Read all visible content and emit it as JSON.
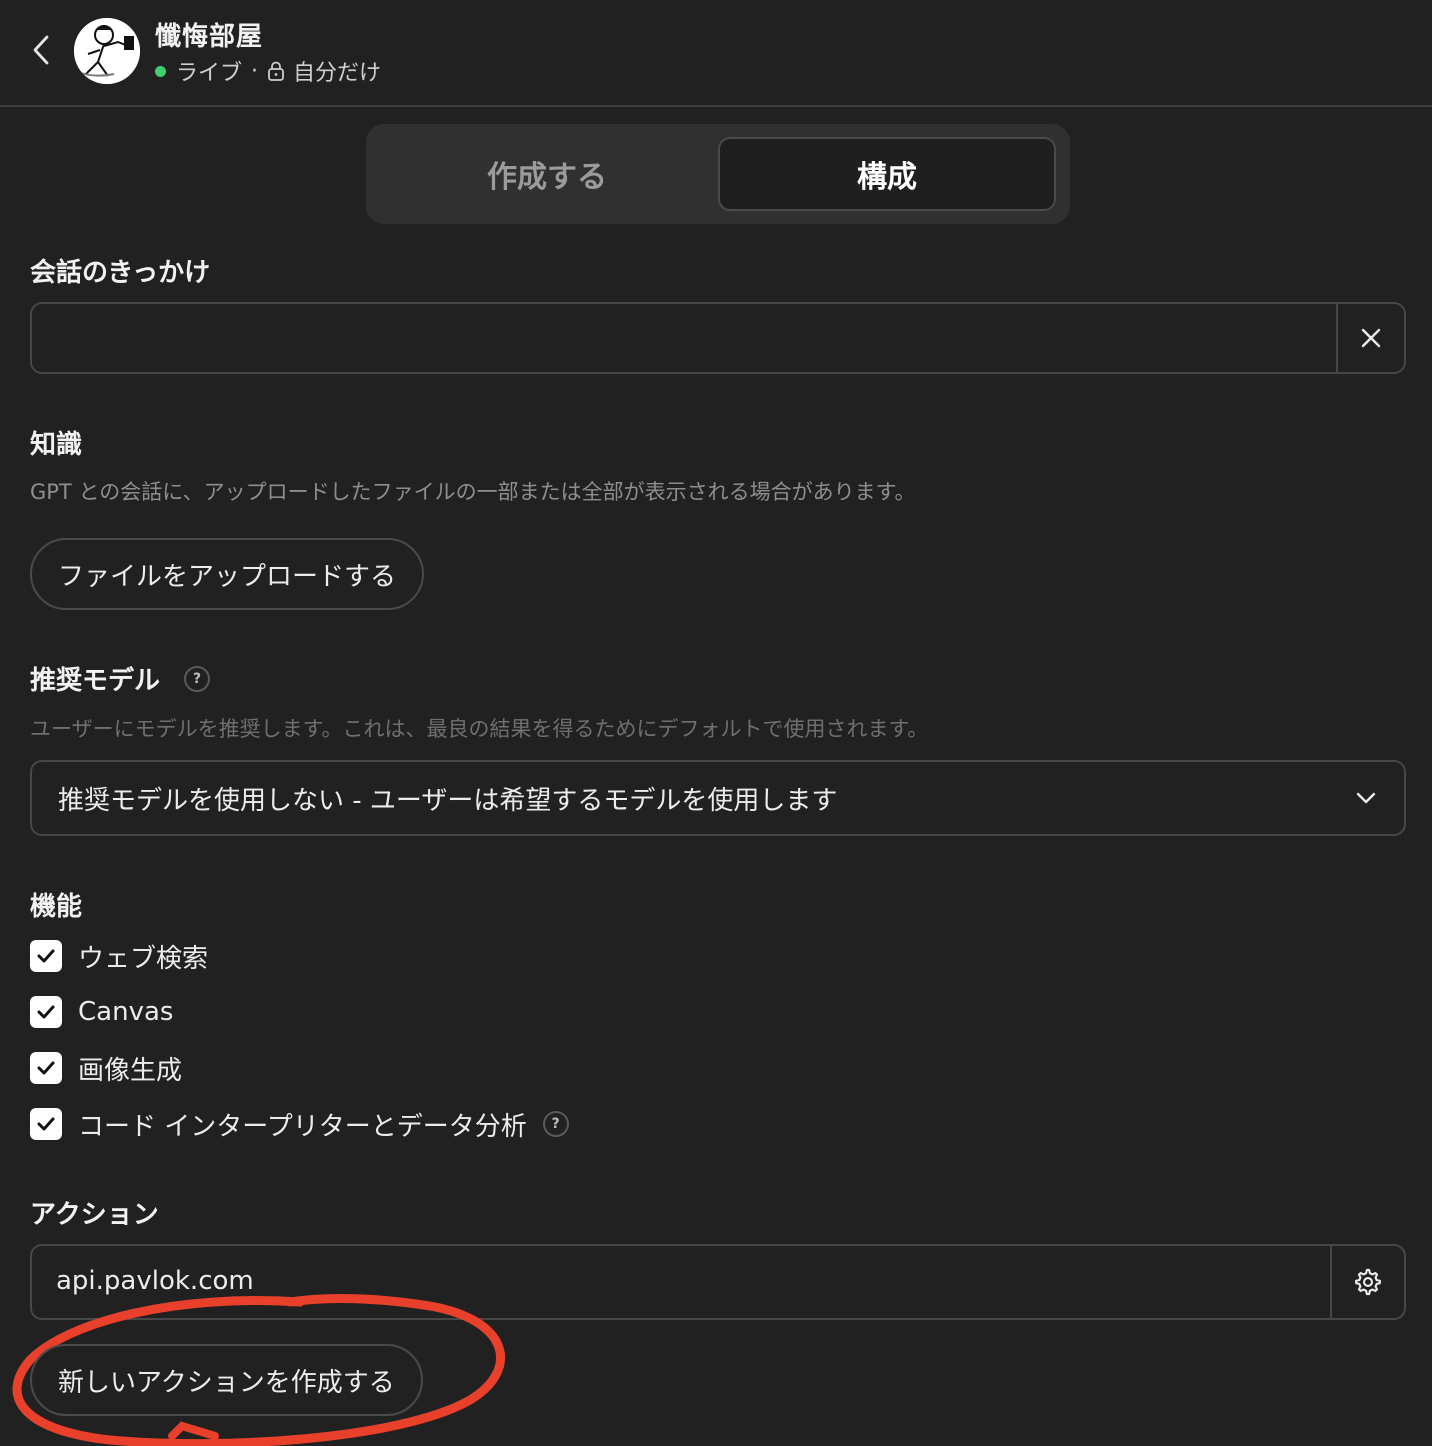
{
  "header": {
    "title": "懺悔部屋",
    "status": "ライブ",
    "separator": "·",
    "visibility": "自分だけ",
    "status_color": "#3ecf6e"
  },
  "tabs": [
    {
      "label": "作成する",
      "active": false
    },
    {
      "label": "構成",
      "active": true
    }
  ],
  "conversation_starters": {
    "title": "会話のきっかけ",
    "value": ""
  },
  "knowledge": {
    "title": "知識",
    "description": "GPT との会話に、アップロードしたファイルの一部または全部が表示される場合があります。",
    "upload_label": "ファイルをアップロードする"
  },
  "recommended_model": {
    "title": "推奨モデル",
    "help": "?",
    "description": "ユーザーにモデルを推奨します。これは、最良の結果を得るためにデフォルトで使用されます。",
    "selected": "推奨モデルを使用しない - ユーザーは希望するモデルを使用します"
  },
  "capabilities": {
    "title": "機能",
    "items": [
      {
        "label": "ウェブ検索",
        "checked": true
      },
      {
        "label": "Canvas",
        "checked": true
      },
      {
        "label": "画像生成",
        "checked": true
      },
      {
        "label": "コード インタープリターとデータ分析",
        "checked": true,
        "help": "?"
      }
    ]
  },
  "actions": {
    "title": "アクション",
    "domain": "api.pavlok.com",
    "create_label": "新しいアクションを作成する"
  },
  "icons": [
    "chevron-left-icon",
    "lock-icon",
    "close-icon",
    "help-icon",
    "chevron-down-icon",
    "checkmark-icon",
    "gear-icon"
  ],
  "annotation_color": "#e8402a"
}
